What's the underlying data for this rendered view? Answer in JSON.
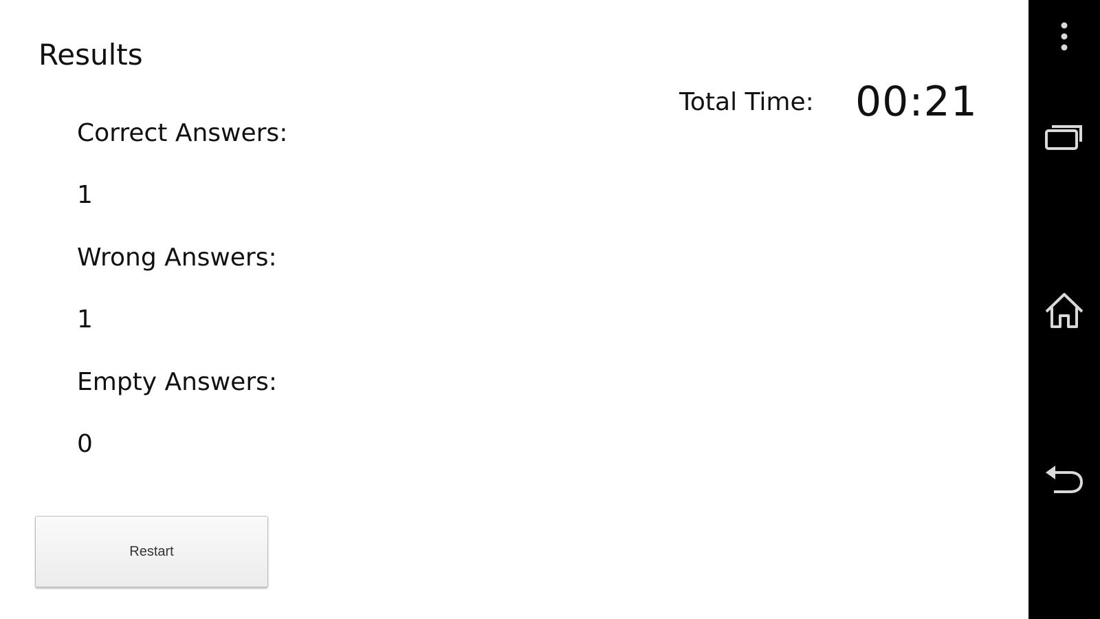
{
  "results": {
    "title": "Results",
    "correct_label": "Correct Answers:",
    "correct_value": "1",
    "wrong_label": "Wrong Answers:",
    "wrong_value": "1",
    "empty_label": "Empty Answers:",
    "empty_value": "0",
    "total_time_label": "Total Time:",
    "total_time_value": "00:21",
    "restart_label": "Restart"
  },
  "nav_bar": {
    "background": "#000000",
    "icon_color": "#d9d9d9",
    "buttons": [
      {
        "icon": "overflow-menu-icon"
      },
      {
        "icon": "recent-apps-icon"
      },
      {
        "icon": "home-icon"
      },
      {
        "icon": "back-icon"
      }
    ]
  }
}
